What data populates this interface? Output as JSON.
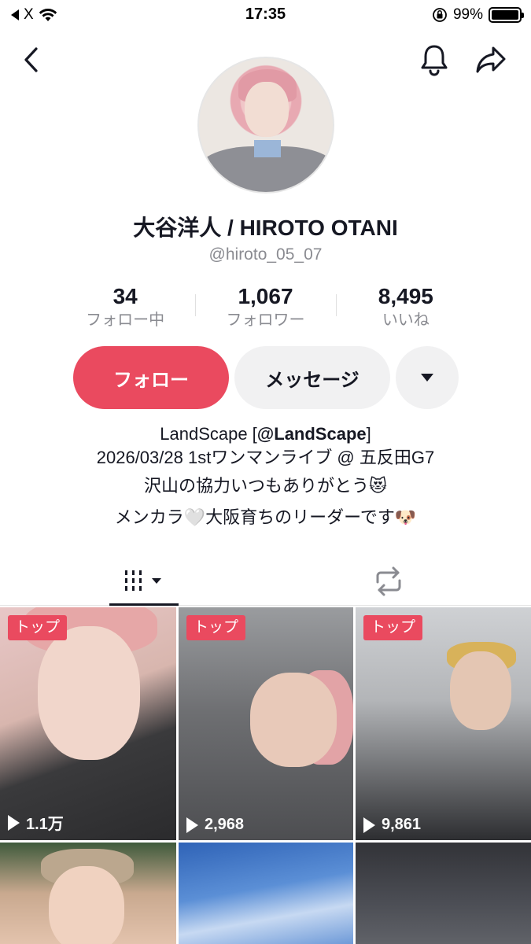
{
  "status_bar": {
    "back_app": "X",
    "time": "17:35",
    "battery": "99%",
    "battery_level": 0.99
  },
  "profile": {
    "display_name": "大谷洋人 / HIROTO OTANI",
    "username": "@hiroto_05_07"
  },
  "stats": [
    {
      "value": "34",
      "label": "フォロー中"
    },
    {
      "value": "1,067",
      "label": "フォロワー"
    },
    {
      "value": "8,495",
      "label": "いいね"
    }
  ],
  "actions": {
    "follow_label": "フォロー",
    "message_label": "メッセージ"
  },
  "bio": {
    "line1_prefix": "LandScape [",
    "line1_mention": "@LandScape",
    "line1_suffix": "]",
    "line2": "2026/03/28 1stワンマンライブ @ 五反田G7",
    "line3": "沢山の協力いつもありがとう😻",
    "line4": "メンカラ🤍大阪育ちのリーダーです🐶"
  },
  "colors": {
    "accent": "#ea4a5f",
    "text_primary": "#161823",
    "text_secondary": "#8a8b91",
    "button_gray": "#f1f1f2"
  },
  "videos": [
    {
      "badge": "トップ",
      "views": "1.1万"
    },
    {
      "badge": "トップ",
      "views": "2,968"
    },
    {
      "badge": "トップ",
      "views": "9,861"
    },
    {
      "badge": "",
      "views": ""
    },
    {
      "badge": "",
      "views": ""
    },
    {
      "badge": "",
      "views": ""
    }
  ]
}
